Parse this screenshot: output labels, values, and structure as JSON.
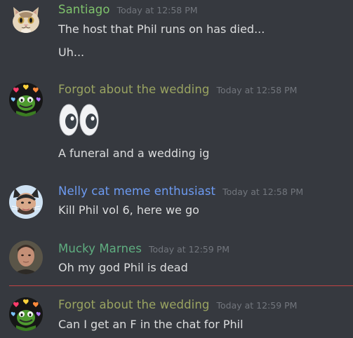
{
  "colors": {
    "background": "#36393f",
    "text": "#dcddde",
    "timestamp": "#72767d",
    "new_messages_divider": "#f04747"
  },
  "messages": [
    {
      "username": "Santiago",
      "username_color": "#7fc36c",
      "timestamp": "Today at 12:58 PM",
      "avatar": "cat-face-avatar",
      "lines": [
        "The host that Phil runs on has died...",
        "Uh..."
      ]
    },
    {
      "username": "Forgot about the wedding",
      "username_color": "#9aa461",
      "timestamp": "Today at 12:58 PM",
      "avatar": "kermit-hearts-avatar",
      "emoji": "eyes-emoji",
      "lines": [
        "A funeral and a wedding ig"
      ]
    },
    {
      "username": "Nelly cat meme enthusiast",
      "username_color": "#6d9bf2",
      "timestamp": "Today at 12:58 PM",
      "avatar": "cat-ears-avatar",
      "lines": [
        "Kill Phil vol 6, here we go"
      ]
    },
    {
      "username": "Mucky Marnes",
      "username_color": "#5fae80",
      "timestamp": "Today at 12:59 PM",
      "avatar": "man-photo-avatar",
      "lines": [
        "Oh my god Phil is dead"
      ]
    },
    {
      "username": "Forgot about the wedding",
      "username_color": "#9aa461",
      "timestamp": "Today at 12:59 PM",
      "avatar": "kermit-hearts-avatar",
      "lines": [
        "Can I get an F in the chat for Phil"
      ]
    }
  ]
}
